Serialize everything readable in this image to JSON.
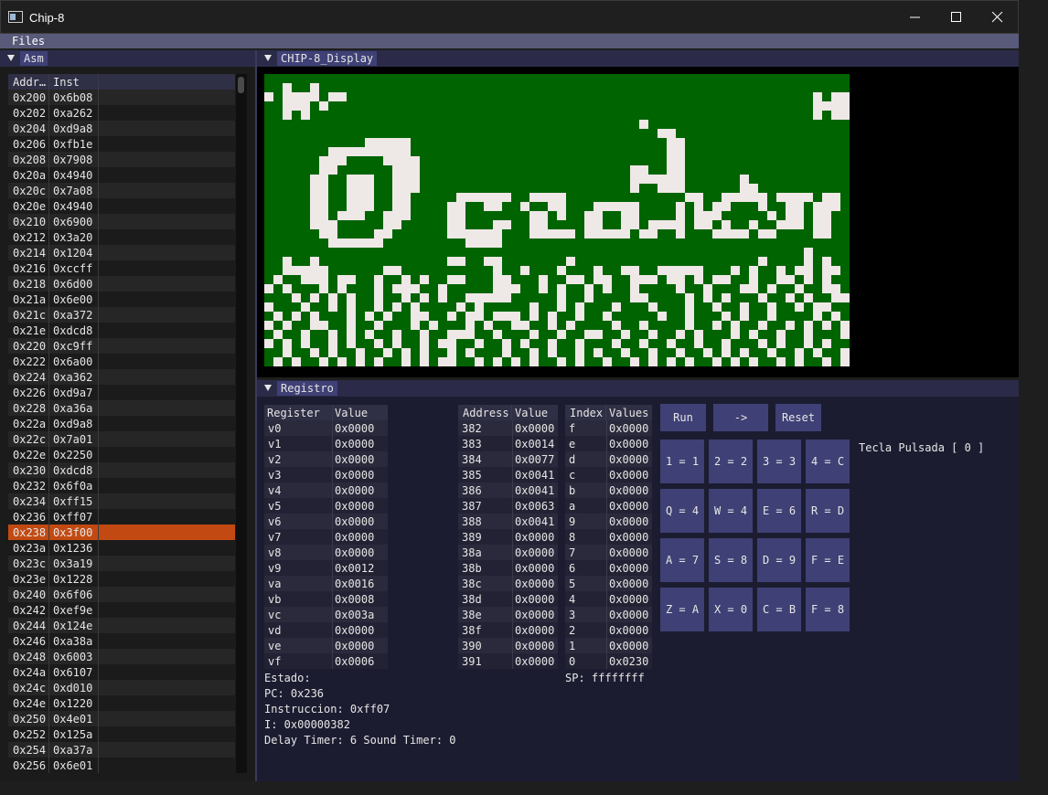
{
  "window": {
    "title": "Chip-8"
  },
  "menu": {
    "files": "Files"
  },
  "asm": {
    "tab": "Asm",
    "headers": [
      "Addr…",
      "Inst"
    ],
    "rows": [
      [
        "0x200",
        "0x6b08"
      ],
      [
        "0x202",
        "0xa262"
      ],
      [
        "0x204",
        "0xd9a8"
      ],
      [
        "0x206",
        "0xfb1e"
      ],
      [
        "0x208",
        "0x7908"
      ],
      [
        "0x20a",
        "0x4940"
      ],
      [
        "0x20c",
        "0x7a08"
      ],
      [
        "0x20e",
        "0x4940"
      ],
      [
        "0x210",
        "0x6900"
      ],
      [
        "0x212",
        "0x3a20"
      ],
      [
        "0x214",
        "0x1204"
      ],
      [
        "0x216",
        "0xccff"
      ],
      [
        "0x218",
        "0x6d00"
      ],
      [
        "0x21a",
        "0x6e00"
      ],
      [
        "0x21c",
        "0xa372"
      ],
      [
        "0x21e",
        "0xdcd8"
      ],
      [
        "0x220",
        "0xc9ff"
      ],
      [
        "0x222",
        "0x6a00"
      ],
      [
        "0x224",
        "0xa362"
      ],
      [
        "0x226",
        "0xd9a7"
      ],
      [
        "0x228",
        "0xa36a"
      ],
      [
        "0x22a",
        "0xd9a8"
      ],
      [
        "0x22c",
        "0x7a01"
      ],
      [
        "0x22e",
        "0x2250"
      ],
      [
        "0x230",
        "0xdcd8"
      ],
      [
        "0x232",
        "0x6f0a"
      ],
      [
        "0x234",
        "0xff15"
      ],
      [
        "0x236",
        "0xff07"
      ],
      [
        "0x238",
        "0x3f00"
      ],
      [
        "0x23a",
        "0x1236"
      ],
      [
        "0x23c",
        "0x3a19"
      ],
      [
        "0x23e",
        "0x1228"
      ],
      [
        "0x240",
        "0x6f06"
      ],
      [
        "0x242",
        "0xef9e"
      ],
      [
        "0x244",
        "0x124e"
      ],
      [
        "0x246",
        "0xa38a"
      ],
      [
        "0x248",
        "0x6003"
      ],
      [
        "0x24a",
        "0x6107"
      ],
      [
        "0x24c",
        "0xd010"
      ],
      [
        "0x24e",
        "0x1220"
      ],
      [
        "0x250",
        "0x4e01"
      ],
      [
        "0x252",
        "0x125a"
      ],
      [
        "0x254",
        "0xa37a"
      ],
      [
        "0x256",
        "0x6e01"
      ]
    ],
    "highlight_index": 28,
    "highlight_color": "#c24a12"
  },
  "display": {
    "tab": "CHIP-8_Display",
    "fg": "#eee8e6",
    "bg": "#006400"
  },
  "registro": {
    "tab": "Registro",
    "reg_headers": [
      "Register",
      "Value"
    ],
    "registers": [
      [
        "v0",
        "0x0000"
      ],
      [
        "v1",
        "0x0000"
      ],
      [
        "v2",
        "0x0000"
      ],
      [
        "v3",
        "0x0000"
      ],
      [
        "v4",
        "0x0000"
      ],
      [
        "v5",
        "0x0000"
      ],
      [
        "v6",
        "0x0000"
      ],
      [
        "v7",
        "0x0000"
      ],
      [
        "v8",
        "0x0000"
      ],
      [
        "v9",
        "0x0012"
      ],
      [
        "va",
        "0x0016"
      ],
      [
        "vb",
        "0x0008"
      ],
      [
        "vc",
        "0x003a"
      ],
      [
        "vd",
        "0x0000"
      ],
      [
        "ve",
        "0x0000"
      ],
      [
        "vf",
        "0x0006"
      ]
    ],
    "mem_headers": [
      "Address",
      "Value"
    ],
    "memory": [
      [
        "382",
        "0x0000"
      ],
      [
        "383",
        "0x0014"
      ],
      [
        "384",
        "0x0077"
      ],
      [
        "385",
        "0x0041"
      ],
      [
        "386",
        "0x0041"
      ],
      [
        "387",
        "0x0063"
      ],
      [
        "388",
        "0x0041"
      ],
      [
        "389",
        "0x0000"
      ],
      [
        "38a",
        "0x0000"
      ],
      [
        "38b",
        "0x0000"
      ],
      [
        "38c",
        "0x0000"
      ],
      [
        "38d",
        "0x0000"
      ],
      [
        "38e",
        "0x0000"
      ],
      [
        "38f",
        "0x0000"
      ],
      [
        "390",
        "0x0000"
      ],
      [
        "391",
        "0x0000"
      ]
    ],
    "stack_headers": [
      "Index",
      "Values"
    ],
    "stack": [
      [
        "f",
        "0x0000"
      ],
      [
        "e",
        "0x0000"
      ],
      [
        "d",
        "0x0000"
      ],
      [
        "c",
        "0x0000"
      ],
      [
        "b",
        "0x0000"
      ],
      [
        "a",
        "0x0000"
      ],
      [
        "9",
        "0x0000"
      ],
      [
        "8",
        "0x0000"
      ],
      [
        "7",
        "0x0000"
      ],
      [
        "6",
        "0x0000"
      ],
      [
        "5",
        "0x0000"
      ],
      [
        "4",
        "0x0000"
      ],
      [
        "3",
        "0x0000"
      ],
      [
        "2",
        "0x0000"
      ],
      [
        "1",
        "0x0000"
      ],
      [
        "0",
        "0x0230"
      ]
    ],
    "sp": "SP: ffffffff",
    "estado": "Estado:",
    "pc": "PC: 0x236",
    "instruccion": "Instruccion: 0xff07",
    "i": "I: 0x00000382",
    "timers": "Delay Timer: 6 Sound Timer: 0",
    "buttons": {
      "run": "Run",
      "step": "->",
      "reset": "Reset"
    },
    "tecla": "Tecla Pulsada [ 0 ]",
    "keys": [
      [
        "1 = 1",
        "2 = 2",
        "3 = 3",
        "4 = C"
      ],
      [
        "Q = 4",
        "W = 4",
        "E = 6",
        "R = D"
      ],
      [
        "A = 7",
        "S = 8",
        "D = 9",
        "F = E"
      ],
      [
        "Z = A",
        "X = 0",
        "C = B",
        "F = 8"
      ]
    ]
  }
}
